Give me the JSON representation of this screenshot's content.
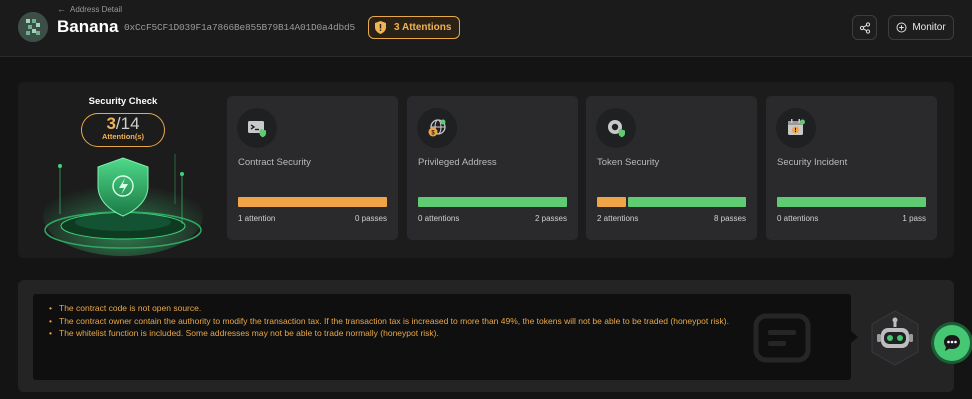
{
  "header": {
    "back_label": "Address Detail",
    "token_name": "Banana",
    "address": "0xCcF5CF1D039F1a7866Be855B79B14A01D0a4dbd5",
    "attention_badge": "3 Attentions",
    "monitor_label": "Monitor",
    "icons": {
      "back": "arrow-left-icon",
      "share": "share-icon",
      "monitor": "plus-circle-icon",
      "badge": "shield-icon"
    }
  },
  "security_check": {
    "title": "Security Check",
    "score": "3",
    "total": "/14",
    "sub": "Attention(s)"
  },
  "cards": [
    {
      "title": "Contract Security",
      "left": "1 attention",
      "right": "0 passes",
      "attention": 1,
      "passes": 0,
      "icon": "code-terminal-icon"
    },
    {
      "title": "Privileged Address",
      "left": "0 attentions",
      "right": "2 passes",
      "attention": 0,
      "passes": 2,
      "icon": "globe-coin-icon"
    },
    {
      "title": "Token Security",
      "left": "2 attentions",
      "right": "8 passes",
      "attention": 2,
      "passes": 8,
      "icon": "token-shield-icon"
    },
    {
      "title": "Security Incident",
      "left": "0 attentions",
      "right": "1 pass",
      "attention": 0,
      "passes": 1,
      "icon": "calendar-alert-icon"
    }
  ],
  "findings": [
    "The contract code is not open source.",
    "The contract owner contain the authority to modify the transaction tax. If the transaction tax is increased to more than 49%, the tokens will not be able to be traded (honeypot risk).",
    "The whitelist function is included. Some addresses may not be able to trade normally (honeypot risk)."
  ],
  "colors": {
    "attention": "#efa546",
    "pass": "#5fcb73",
    "accent_green": "#46c774",
    "background": "#141414"
  }
}
